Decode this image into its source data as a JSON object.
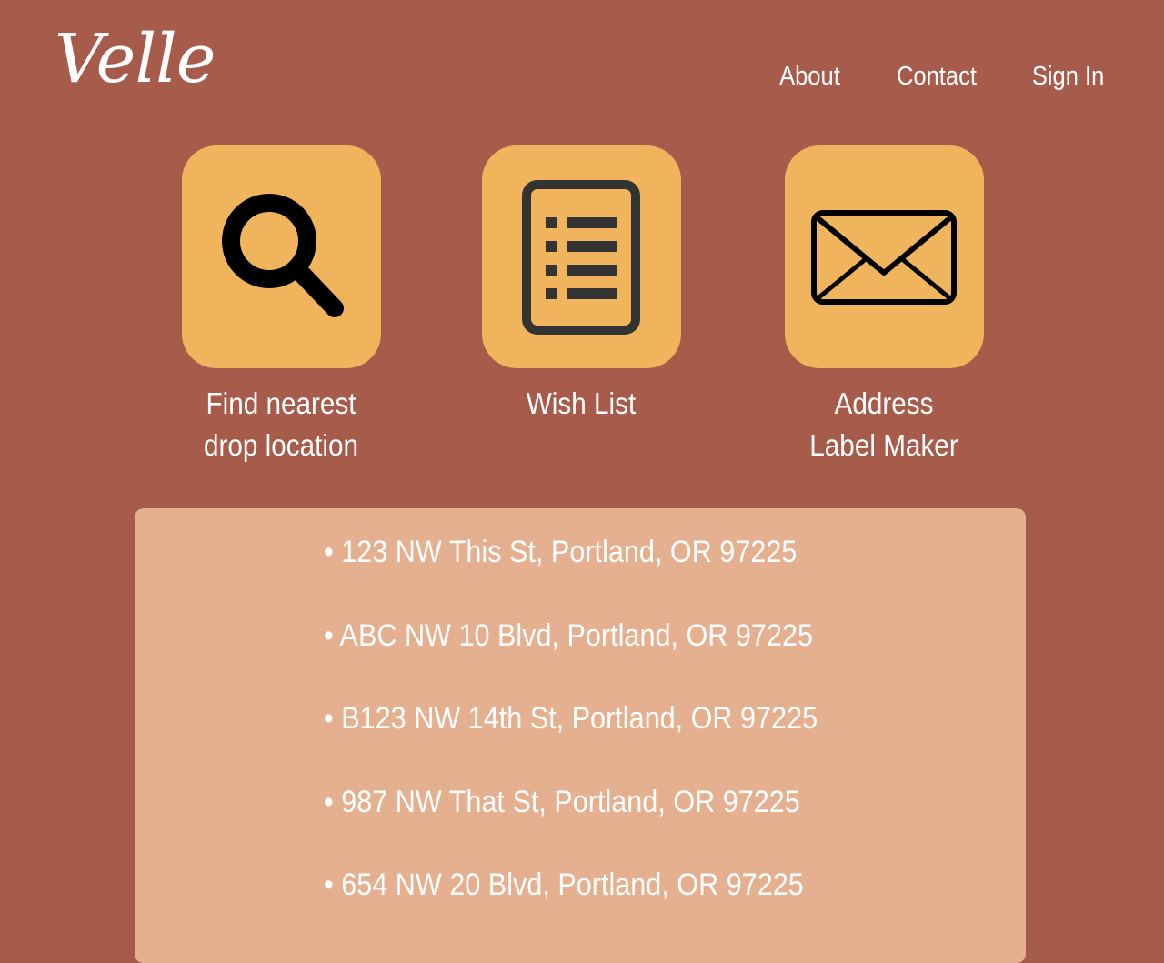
{
  "header": {
    "logo": "Velle",
    "nav": [
      "About",
      "Contact",
      "Sign In"
    ]
  },
  "tiles": [
    {
      "label": "Find nearest\ndrop location",
      "icon": "search-icon"
    },
    {
      "label": "Wish List",
      "icon": "list-icon"
    },
    {
      "label": "Address\nLabel Maker",
      "icon": "envelope-icon"
    }
  ],
  "locations": [
    "123 NW This St, Portland, OR 97225",
    "ABC NW 10 Blvd, Portland, OR 97225",
    "B123 NW 14th St, Portland, OR 97225",
    "987 NW That St, Portland, OR 97225",
    "654 NW 20 Blvd, Portland, OR 97225"
  ],
  "colors": {
    "background": "#a75b4b",
    "tile": "#efb45c",
    "panel": "#e5b08f",
    "text": "#ffffff",
    "icon": "#000000"
  }
}
